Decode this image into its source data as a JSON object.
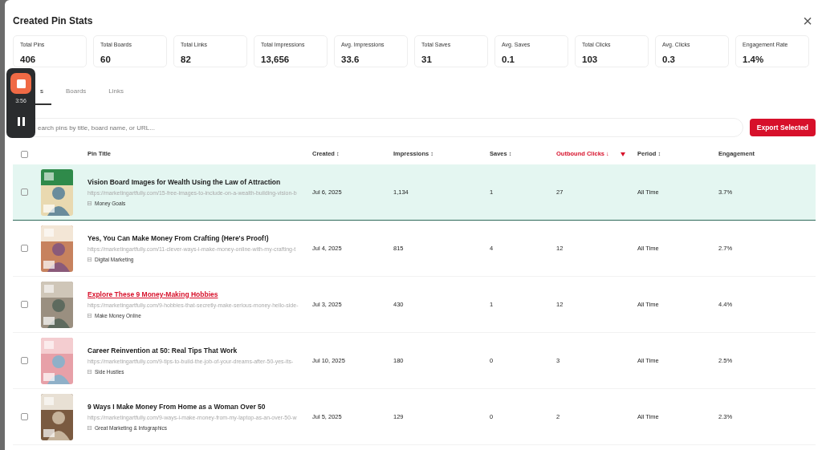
{
  "dialog": {
    "title": "Created Pin Stats",
    "close": "×"
  },
  "stats": [
    {
      "label": "Total Pins",
      "value": "406"
    },
    {
      "label": "Total Boards",
      "value": "60"
    },
    {
      "label": "Total Links",
      "value": "82"
    },
    {
      "label": "Total Impressions",
      "value": "13,656"
    },
    {
      "label": "Avg. Impressions",
      "value": "33.6"
    },
    {
      "label": "Total Saves",
      "value": "31"
    },
    {
      "label": "Avg. Saves",
      "value": "0.1"
    },
    {
      "label": "Total Clicks",
      "value": "103"
    },
    {
      "label": "Avg. Clicks",
      "value": "0.3"
    },
    {
      "label": "Engagement Rate",
      "value": "1.4%"
    }
  ],
  "tabs": [
    {
      "label": "s",
      "selected": true
    },
    {
      "label": "Boards",
      "selected": false
    },
    {
      "label": "Links",
      "selected": false
    }
  ],
  "search": {
    "placeholder": "earch pins by title, board name, or URL..."
  },
  "export_button": "Export Selected",
  "recorder": {
    "time": "3:56"
  },
  "table": {
    "select_all_checked": false,
    "columns": [
      {
        "label": "Pin Title",
        "sorted": false
      },
      {
        "label": "Created ↕",
        "sorted": false
      },
      {
        "label": "Impressions ↕",
        "sorted": false
      },
      {
        "label": "Saves ↕",
        "sorted": false
      },
      {
        "label": "Outbound Clicks ↓",
        "sorted": true
      },
      {
        "label": "Period ↕",
        "sorted": false
      },
      {
        "label": "Engagement",
        "sorted": false
      }
    ],
    "rows": [
      {
        "checked": false,
        "selected": true,
        "hovered": false,
        "title": "Vision Board Images for Wealth Using the Law of Attraction",
        "url": "https://marketingartfully.com/15-free-images-to-include-on-a-wealth-building-vision-b",
        "board": "Money Goals",
        "created": "Jul 6, 2025",
        "impressions": "1,134",
        "saves": "1",
        "clicks": "27",
        "period": "All Time",
        "engagement": "3.7%"
      },
      {
        "checked": false,
        "selected": false,
        "hovered": false,
        "title": "Yes, You Can Make Money From Crafting (Here's Proof!)",
        "url": "https://marketingartfully.com/11-clever-ways-i-make-money-online-with-my-crafting-t",
        "board": "Digital Marketing",
        "created": "Jul 4, 2025",
        "impressions": "815",
        "saves": "4",
        "clicks": "12",
        "period": "All Time",
        "engagement": "2.7%"
      },
      {
        "checked": false,
        "selected": false,
        "hovered": true,
        "title": "Explore These 9 Money-Making Hobbies",
        "url": "https://marketingartfully.com/9-hobbies-that-secretly-make-serious-money-hello-side-",
        "board": "Make Money Online",
        "created": "Jul 3, 2025",
        "impressions": "430",
        "saves": "1",
        "clicks": "12",
        "period": "All Time",
        "engagement": "4.4%"
      },
      {
        "checked": false,
        "selected": false,
        "hovered": false,
        "title": "Career Reinvention at 50: Real Tips That Work",
        "url": "https://marketingartfully.com/9-tips-to-build-the-job-of-your-dreams-after-50-yes-its-",
        "board": "Side Hustles",
        "created": "Jul 10, 2025",
        "impressions": "180",
        "saves": "0",
        "clicks": "3",
        "period": "All Time",
        "engagement": "2.5%"
      },
      {
        "checked": false,
        "selected": false,
        "hovered": false,
        "title": "9 Ways I Make Money From Home as a Woman Over 50",
        "url": "https://marketingartfully.com/9-ways-i-make-money-from-my-laptop-as-an-over-50-w",
        "board": "Great Marketing & Infographics",
        "created": "Jul 5, 2025",
        "impressions": "129",
        "saves": "0",
        "clicks": "2",
        "period": "All Time",
        "engagement": "2.3%"
      }
    ]
  }
}
